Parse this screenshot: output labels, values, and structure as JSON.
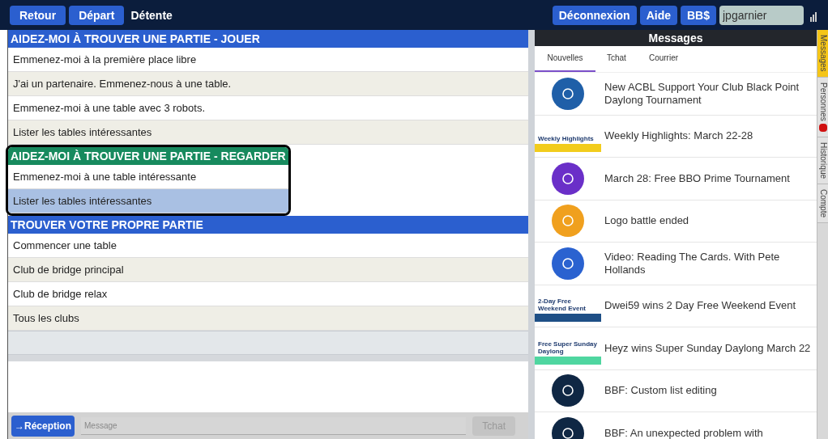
{
  "top_bar": {
    "left_buttons": [
      "Retour",
      "Départ"
    ],
    "title": "Détente",
    "right_buttons": [
      "Déconnexion",
      "Aide",
      "BB$"
    ],
    "username": "jpgarnier"
  },
  "sections": [
    {
      "title": "AIDEZ-MOI À TROUVER UNE PARTIE - JOUER",
      "color": "#2b5fcf",
      "outlined": false,
      "items": [
        {
          "label": "Emmenez-moi à la première place libre",
          "selected": false
        },
        {
          "label": "J'ai un partenaire. Emmenez-nous à une table.",
          "selected": false
        },
        {
          "label": "Emmenez-moi à une table avec 3 robots.",
          "selected": false
        },
        {
          "label": "Lister les tables intéressantes",
          "selected": false
        }
      ]
    },
    {
      "title": "AIDEZ-MOI À TROUVER UNE PARTIE - REGARDER",
      "color": "#178a5e",
      "outlined": true,
      "items": [
        {
          "label": "Emmenez-moi à une table intéressante",
          "selected": false
        },
        {
          "label": "Lister les tables intéressantes",
          "selected": true
        }
      ]
    },
    {
      "title": "TROUVER VOTRE PROPRE PARTIE",
      "color": "#2b5fcf",
      "outlined": false,
      "items": [
        {
          "label": "Commencer une table",
          "selected": false
        },
        {
          "label": "Club de bridge principal",
          "selected": false
        },
        {
          "label": "Club de bridge relax",
          "selected": false
        },
        {
          "label": "Tous les clubs",
          "selected": false
        }
      ]
    }
  ],
  "chat_bar": {
    "button": "→Réception",
    "placeholder": "Message",
    "send": "Tchat"
  },
  "messages": {
    "title": "Messages",
    "tabs": [
      {
        "label": "Nouvelles",
        "selected": true
      },
      {
        "label": "Tchat",
        "selected": false
      },
      {
        "label": "Courrier",
        "selected": false
      }
    ],
    "news": [
      {
        "kind": "circle",
        "color": "#1f5fa8",
        "text": "New ACBL Support Your Club Black Point Daylong Tournament"
      },
      {
        "kind": "banner",
        "color": "#f2cc1c",
        "banner": "Weekly Highlights",
        "text": "Weekly Highlights: March 22-28"
      },
      {
        "kind": "circle",
        "color": "#6a2fc8",
        "text": "March 28: Free BBO Prime Tournament"
      },
      {
        "kind": "circle",
        "color": "#f0a01e",
        "text": "Logo battle ended"
      },
      {
        "kind": "circle",
        "color": "#2a62d0",
        "text": "Video: Reading The Cards. With Pete Hollands"
      },
      {
        "kind": "banner",
        "color": "#1e4f86",
        "banner": "2-Day Free Weekend Event",
        "text": "Dwei59 wins 2 Day Free Weekend Event"
      },
      {
        "kind": "banner",
        "color": "#4fd6a0",
        "banner": "Free Super Sunday Daylong",
        "text": "Heyz wins Super Sunday Daylong March 22"
      },
      {
        "kind": "circle",
        "color": "#0f2744",
        "text": "BBF: Custom list editing"
      },
      {
        "kind": "circle",
        "color": "#0f2744",
        "text": "BBF: An unexpected problem with"
      }
    ]
  },
  "side_tabs": [
    {
      "label": "Messages",
      "selected": true,
      "badge": false
    },
    {
      "label": "Personnes",
      "selected": false,
      "badge": true
    },
    {
      "label": "Historique",
      "selected": false,
      "badge": false
    },
    {
      "label": "Compte",
      "selected": false,
      "badge": false
    }
  ]
}
